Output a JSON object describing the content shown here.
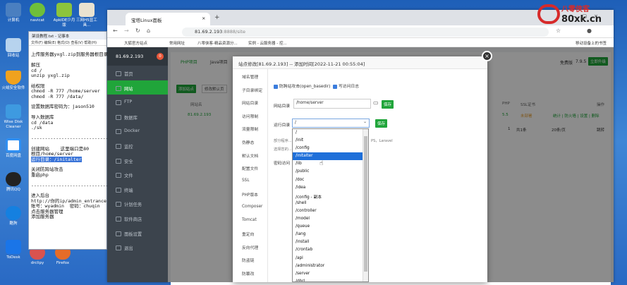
{
  "desktop": {
    "icons": [
      {
        "label": "计算机",
        "name": "computer-icon"
      },
      {
        "label": "navicat",
        "name": "navicat-icon"
      },
      {
        "label": "ApkIDE少月版",
        "name": "apkide-icon"
      },
      {
        "label": "三网H5显工具...",
        "name": "h5-tool-icon"
      },
      {
        "label": "回收站",
        "name": "recycle-bin-icon"
      },
      {
        "label": "火绒安全软件",
        "name": "huorong-icon"
      },
      {
        "label": "Wise Disk Cleaner",
        "name": "wise-disk-cleaner-icon"
      },
      {
        "label": "百度网盘",
        "name": "baidu-netdisk-icon"
      },
      {
        "label": "腾讯QQ",
        "name": "qq-icon"
      },
      {
        "label": "酷狗",
        "name": "kugou-icon"
      },
      {
        "label": "ToDesk",
        "name": "todesk-icon"
      },
      {
        "label": "drclipy",
        "name": "drclipy-icon"
      },
      {
        "label": "Firefox",
        "name": "firefox-icon"
      }
    ]
  },
  "notepad": {
    "title": "架设教程.txt - 记事本",
    "menu": "文件(F) 编辑(E) 格式(O) 查看(V) 帮助(H)",
    "lines": [
      "",
      "上传服务器yxgl.zip到服务器根目录",
      "",
      "解压",
      "cd /",
      "unzip yxgl.zip",
      "",
      "给权限",
      "chmod -R 777 /home/server",
      "chmod -R 777 /data/",
      "",
      "设置数据库密码为：jason510",
      "",
      "导入数据库",
      "cd /data",
      "./sk",
      "",
      "----------------------------",
      "",
      "创建网站    这里端口是80",
      "根目/home/server",
      "",
      "关闭防跨站攻击",
      "重启php",
      "",
      "----------------------------",
      "",
      "进入后台",
      "http://你的ip/admin_entrance.php",
      "账号：wyadmin  密码：chuqin",
      "点击服务器管理",
      "添加服务器"
    ],
    "highlighted_line": "运行目录：/initalter"
  },
  "browser": {
    "tab_title": "宝塔Linux面板",
    "url_host": "81.69.2.193",
    "url_rest": ":8888/site",
    "bookmarks": [
      "大狐官方站点",
      "常用网址",
      "八零侠客-精品资源分...",
      "实例 - 云服务器 - 控...",
      "移动设备上的书签"
    ]
  },
  "panel": {
    "ip": "81.69.2.193",
    "badge": "0",
    "menu": [
      "首页",
      "网站",
      "FTP",
      "数据库",
      "Docker",
      "监控",
      "安全",
      "文件",
      "终端",
      "计划任务",
      "软件商店",
      "面板设置",
      "退出"
    ],
    "active_menu": "网站",
    "tabs": [
      "PHP项目",
      "Java项目"
    ],
    "buttons": {
      "add_site": "添加站点",
      "modify_default": "修改默认页",
      "save": "保存"
    },
    "table_headers": [
      "网站名",
      "PHP",
      "SSL证书",
      "操作"
    ],
    "row": {
      "name": "81.69.2.193",
      "php": "5.5",
      "ssl": "未部署",
      "ops": "统计 | 防火墙 | 设置 | 删除"
    },
    "pagination": {
      "page": "1",
      "total": "共1条",
      "per_page": "20条/页",
      "jump": "跳转"
    },
    "top_right": {
      "brand": "免费版",
      "version": "7.9.5",
      "upgrade": "立即升级"
    }
  },
  "modal": {
    "title": "站点修改[81.69.2.193] -- 添加时间[2022-11-21 00:55:04]",
    "close": "×",
    "nav": [
      "域名管理",
      "子目录绑定",
      "网站目录",
      "访问限制",
      "流量限制",
      "伪静态",
      "默认文档",
      "配置文件",
      "SSL",
      "PHP版本",
      "Composer",
      "Tomcat",
      "重定向",
      "反向代理",
      "防盗链",
      "防篡改"
    ],
    "checkbox1": "防跨站攻击(open_basedir)",
    "checkbox2": "写访问日志",
    "site_dir_label": "网站目录",
    "site_dir_value": "/home/server",
    "save": "保存",
    "run_dir_label": "运行目录",
    "run_dir_value": "/",
    "tips": [
      "部分程序...",
      "选择您的..."
    ],
    "tips_right": "PS，Laravel",
    "pwd_label": "密码访问"
  },
  "dropdown": {
    "items": [
      "/",
      "/init",
      "/config",
      "/initalter",
      "/lib",
      "/public",
      "/doc",
      "/idea",
      "/config - 副本",
      "/shell",
      "/controller",
      "/model",
      "/queue",
      "/lang",
      "/install",
      "/crontab",
      "/api",
      "/administrator",
      "/server",
      "/dbrl"
    ],
    "selected": "/initalter"
  },
  "watermark": {
    "site": "80xk.cn",
    "brand": "八零侠客"
  }
}
